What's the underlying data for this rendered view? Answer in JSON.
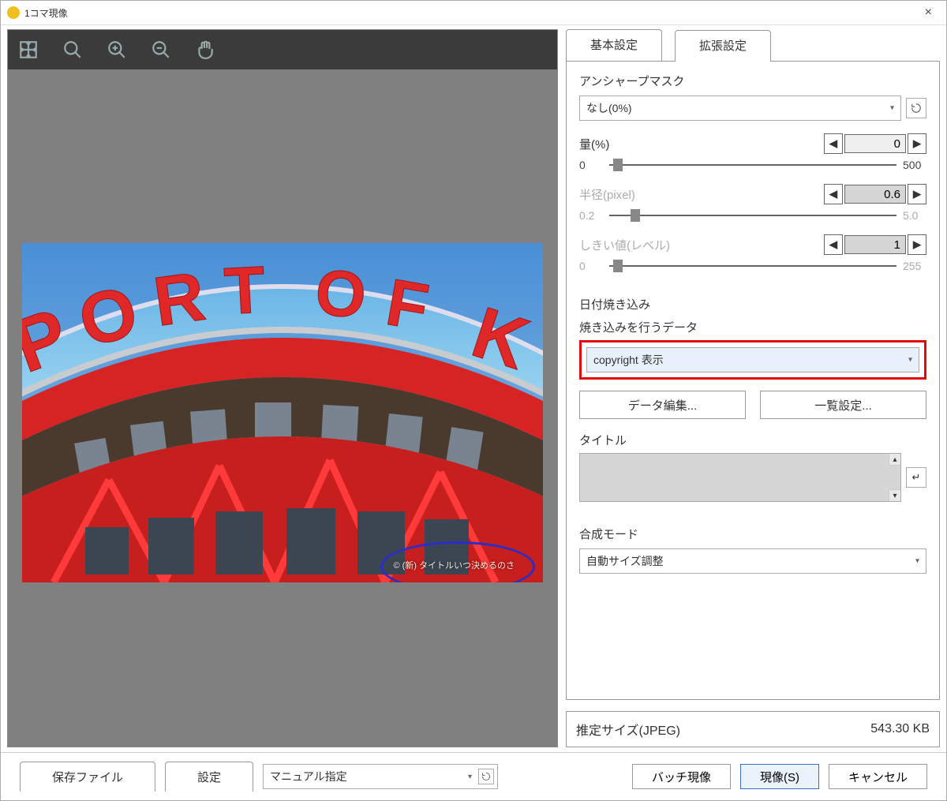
{
  "window": {
    "title": "1コマ現像"
  },
  "tabs": {
    "basic": "基本設定",
    "advanced": "拡張設定"
  },
  "unsharp": {
    "group": "アンシャープマスク",
    "preset": "なし(0%)",
    "amount_label": "量(%)",
    "amount_value": "0",
    "amount_min": "0",
    "amount_max": "500",
    "radius_label": "半径(pixel)",
    "radius_value": "0.6",
    "radius_min": "0.2",
    "radius_max": "5.0",
    "threshold_label": "しきい値(レベル)",
    "threshold_value": "1",
    "threshold_min": "0",
    "threshold_max": "255"
  },
  "burnin": {
    "group": "日付焼き込み",
    "data_label": "焼き込みを行うデータ",
    "selected": "copyright 表示",
    "edit_btn": "データ編集...",
    "list_btn": "一覧設定...",
    "title_label": "タイトル"
  },
  "composite": {
    "label": "合成モード",
    "selected": "自動サイズ調整"
  },
  "estimate": {
    "label": "推定サイズ(JPEG)",
    "value": "543.30 KB"
  },
  "bottom": {
    "save_tab": "保存ファイル",
    "settings_tab": "設定",
    "manual": "マニュアル指定",
    "batch": "バッチ現像",
    "develop": "現像(S)",
    "cancel": "キャンセル"
  },
  "overlay": {
    "copyright": "© (新) タイトルいつ決めるのさ"
  }
}
